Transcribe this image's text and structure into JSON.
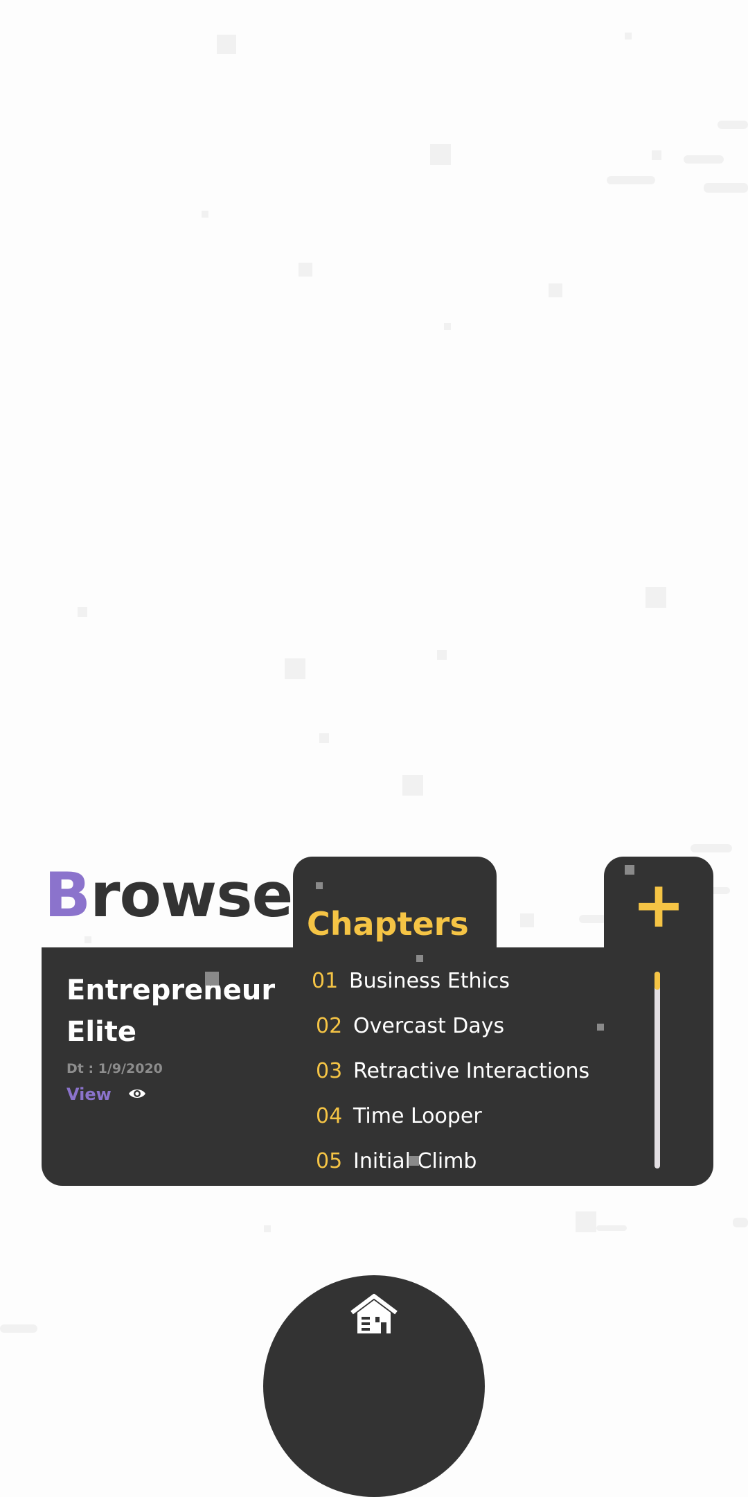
{
  "header": {
    "title_first_letter": "B",
    "title_rest": "rowse",
    "chapters_tab_label": "Chapters",
    "add_button_label": "+"
  },
  "book": {
    "title": "Entrepreneur Elite",
    "date": "Dt : 1/9/2020",
    "view_label": "View",
    "view_icon": "eye-icon"
  },
  "chapters": [
    {
      "number": "01",
      "title": "Business Ethics"
    },
    {
      "number": "02",
      "title": "Overcast Days"
    },
    {
      "number": "03",
      "title": "Retractive Interactions"
    },
    {
      "number": "04",
      "title": "Time Looper"
    },
    {
      "number": "05",
      "title": "Initial Climb"
    }
  ],
  "scroll_position": 0,
  "nav": {
    "home_icon": "home-icon"
  },
  "colors": {
    "accent_purple": "#8b73cc",
    "accent_yellow": "#f5c445",
    "card_dark": "#333333",
    "text_dark": "#333333"
  }
}
